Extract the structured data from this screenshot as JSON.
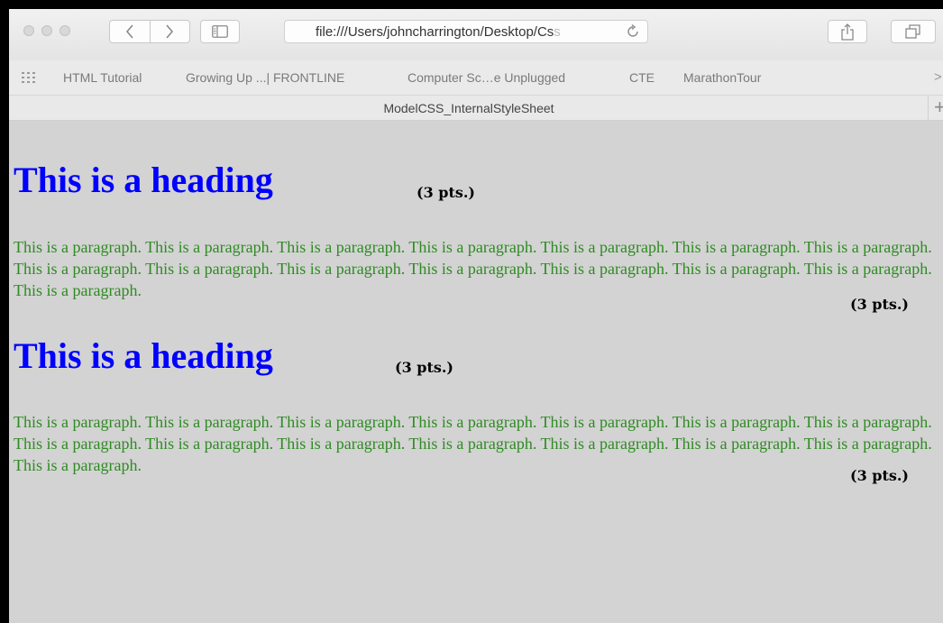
{
  "browser": {
    "url_text": "file:///Users/johncharrington/Desktop/Cs",
    "url_tail": "s",
    "tab_title": "ModelCSS_InternalStyleSheet"
  },
  "bookmarks": [
    "HTML Tutorial",
    "Growing Up ...| FRONTLINE",
    "Computer Sc…e Unplugged",
    "CTE",
    "MarathonTour"
  ],
  "page": {
    "heading_1": "This is a heading",
    "paragraph_1": "This is a paragraph. This is a paragraph. This is a paragraph. This is a paragraph. This is a paragraph. This is a paragraph. This is a paragraph. This is a paragraph. This is a paragraph. This is a paragraph. This is a paragraph. This is a paragraph. This is a paragraph. This is a paragraph. This is a paragraph.",
    "heading_2": "This is a heading",
    "paragraph_2": "This is a paragraph. This is a paragraph. This is a paragraph. This is a paragraph. This is a paragraph. This is a paragraph. This is a paragraph. This is a paragraph. This is a paragraph. This is a paragraph. This is a paragraph. This is a paragraph. This is a paragraph. This is a paragraph. This is a paragraph."
  },
  "annotations": {
    "heading_1_pts": "(3 pts.)",
    "paragraph_1_pts": "(3 pts.)",
    "heading_2_pts": "(3 pts.)",
    "paragraph_2_pts": "(3 pts.)"
  },
  "colors": {
    "heading": "#0000ff",
    "paragraph": "#2e8b22",
    "page_background": "#d3d3d3"
  },
  "icons": [
    "close-window-icon",
    "minimize-window-icon",
    "zoom-window-icon",
    "back-icon",
    "forward-icon",
    "sidebar-icon",
    "reload-icon",
    "share-icon",
    "tabs-overview-icon",
    "bookmarks-grid-icon",
    "more-bookmarks-chevron-icon",
    "new-tab-icon"
  ]
}
